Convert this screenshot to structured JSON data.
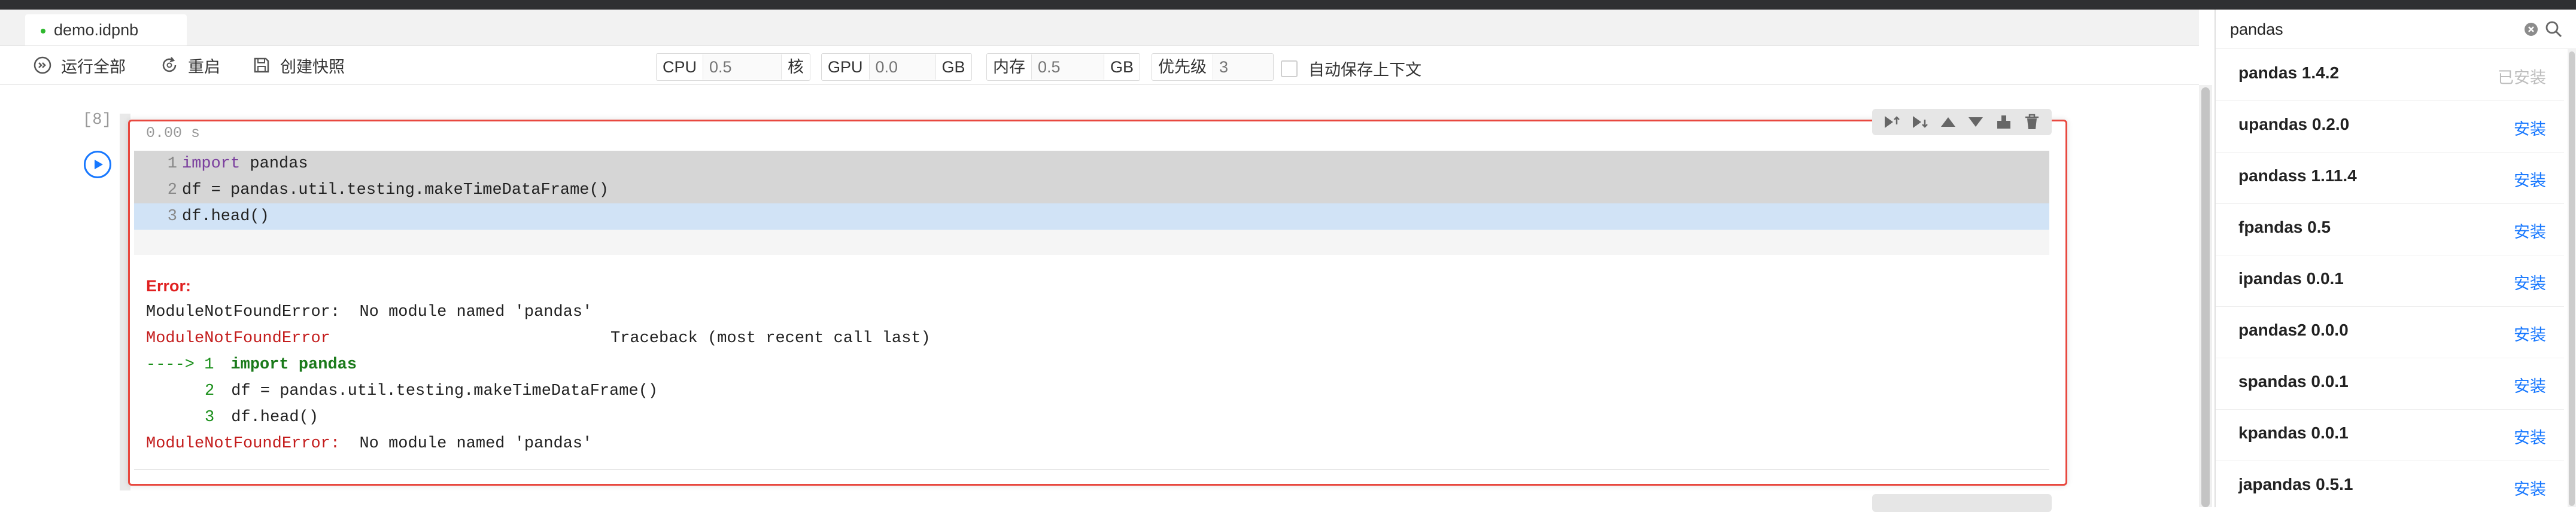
{
  "tab": {
    "label": "demo.idpnb"
  },
  "toolbar": {
    "run_all": "运行全部",
    "restart": "重启",
    "snapshot": "创建快照",
    "cpu": {
      "label": "CPU",
      "placeholder": "0.5",
      "unit": "核"
    },
    "gpu": {
      "label": "GPU",
      "placeholder": "0.0",
      "unit": "GB"
    },
    "memory": {
      "label": "内存",
      "placeholder": "0.5",
      "unit": "GB"
    },
    "priority": {
      "label": "优先级",
      "placeholder": "3"
    },
    "autosave": "自动保存上下文"
  },
  "cell": {
    "exec_count": "[8]",
    "exec_time": "0.00 s",
    "code": [
      {
        "n": "1",
        "kw": "import",
        "rest": " pandas"
      },
      {
        "n": "2",
        "kw": "",
        "rest": "df = pandas.util.testing.makeTimeDataFrame()"
      },
      {
        "n": "3",
        "kw": "",
        "rest": "df.head()"
      }
    ],
    "output": {
      "title": "Error:",
      "message": "ModuleNotFoundError:  No module named 'pandas'",
      "tb_name": "ModuleNotFoundError",
      "tb_header": "Traceback (most recent call last)",
      "arrow": "----> 1",
      "tb_line1": "import pandas",
      "tb_n2": "2",
      "tb_line2": "df = pandas.util.testing.makeTimeDataFrame()",
      "tb_n3": "3",
      "tb_line3": "df.head()",
      "final_name": "ModuleNotFoundError:",
      "final_msg": "  No module named 'pandas'"
    }
  },
  "search": {
    "value": "pandas"
  },
  "packages": [
    {
      "name": "pandas 1.4.2",
      "action": "已安装",
      "installed": true
    },
    {
      "name": "upandas 0.2.0",
      "action": "安装",
      "installed": false
    },
    {
      "name": "pandass 1.11.4",
      "action": "安装",
      "installed": false
    },
    {
      "name": "fpandas 0.5",
      "action": "安装",
      "installed": false
    },
    {
      "name": "ipandas 0.0.1",
      "action": "安装",
      "installed": false
    },
    {
      "name": "pandas2 0.0.0",
      "action": "安装",
      "installed": false
    },
    {
      "name": "spandas 0.0.1",
      "action": "安装",
      "installed": false
    },
    {
      "name": "kpandas 0.0.1",
      "action": "安装",
      "installed": false
    },
    {
      "name": "japandas 0.5.1",
      "action": "安装",
      "installed": false
    }
  ]
}
